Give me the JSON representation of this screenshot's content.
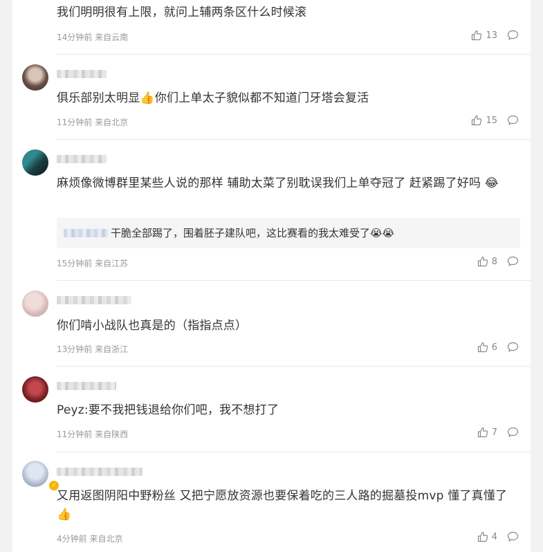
{
  "comments": [
    {
      "text": "我们明明很有上限，就问上辅两条区什么时候滚",
      "meta": "14分钟前 来自云南",
      "likes": "13"
    },
    {
      "text": "俱乐部别太明显👍你们上单太子貌似都不知道门牙塔会复活",
      "meta": "11分钟前 来自北京",
      "likes": "15"
    },
    {
      "text": "麻烦像微博群里某些人说的那样 辅助太菜了别耽误我们上单夺冠了 赶紧踢了好吗 😂",
      "meta": "15分钟前 来自江苏",
      "likes": "8",
      "reply": "干脆全部踢了，围着胚子建队吧，这比赛看的我太难受了😭😭"
    },
    {
      "text": "你们啃小战队也真是的（指指点点）",
      "meta": "13分钟前 来自浙江",
      "likes": "6"
    },
    {
      "text": "Peyz:要不我把钱退给你们吧，我不想打了",
      "meta": "11分钟前 来自陕西",
      "likes": "7"
    },
    {
      "text": "又用返图阴阳中野粉丝 又把宁愿放资源也要保着吃的三人路的掘墓投mvp 懂了真懂了👍",
      "meta": "4分钟前 来自北京",
      "likes": "4"
    }
  ],
  "icons": {
    "like": "thumbs-up-icon",
    "reply": "speech-bubble-icon",
    "verified": "verified-badge-icon"
  },
  "colors": {
    "meta": "#999999",
    "text": "#333333",
    "badge": "#f6b500"
  }
}
